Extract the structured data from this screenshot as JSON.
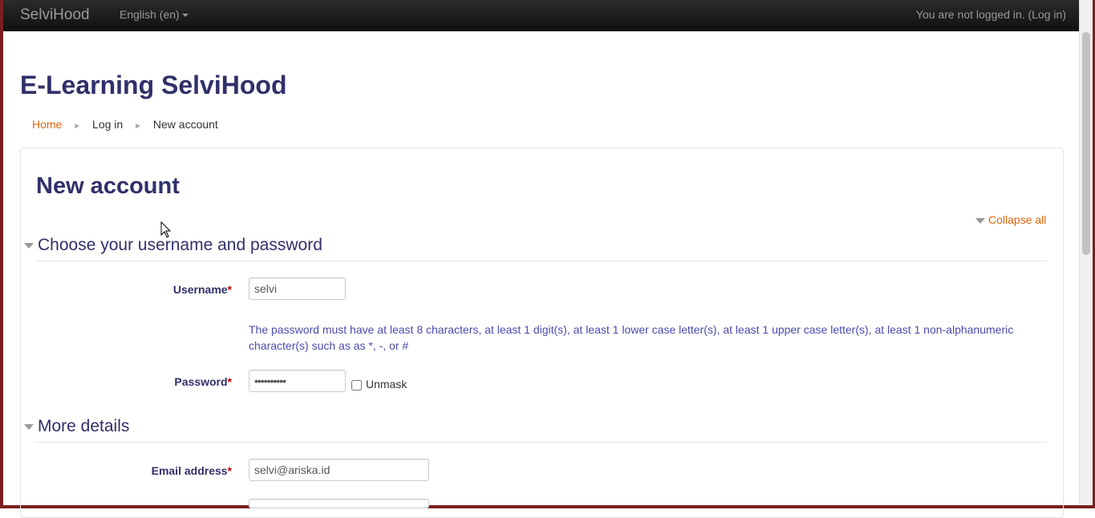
{
  "navbar": {
    "brand": "SelviHood",
    "language": "English (en)",
    "login_status": "You are not logged in. (",
    "login_link": "Log in",
    "login_close": ")"
  },
  "site_title": "E-Learning SelviHood",
  "breadcrumb": {
    "items": [
      "Home",
      "Log in",
      "New account"
    ]
  },
  "page_heading": "New account",
  "collapse_all": "Collapse all",
  "sections": {
    "credentials": {
      "legend": "Choose your username and password",
      "username_label": "Username",
      "username_value": "selvi",
      "password_policy": "The password must have at least 8 characters, at least 1 digit(s), at least 1 lower case letter(s), at least 1 upper case letter(s), at least 1 non-alphanumeric character(s) such as as *, -, or #",
      "password_label": "Password",
      "password_value": "••••••••••",
      "unmask_label": "Unmask"
    },
    "details": {
      "legend": "More details",
      "email_label": "Email address",
      "email_value": "selvi@ariska.id"
    }
  },
  "required_marker": "*",
  "colors": {
    "accent": "#e2650d",
    "heading": "#30306a",
    "required": "#cc0000",
    "navbar": "#1b1b1b"
  }
}
